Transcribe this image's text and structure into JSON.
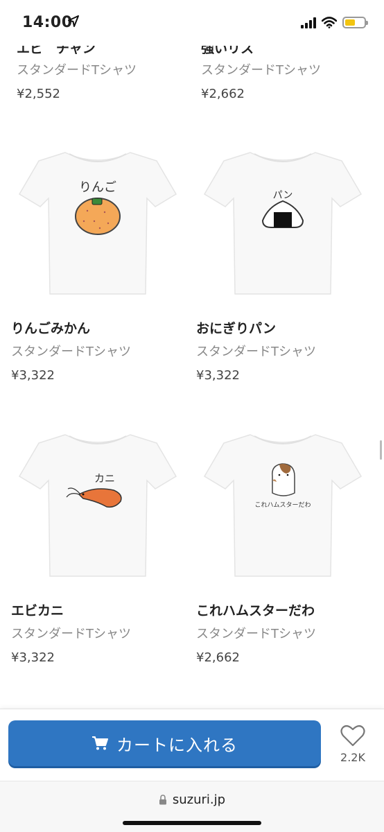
{
  "status_bar": {
    "time": "14:00",
    "location_icon": "location-arrow-icon",
    "signal_icon": "cellular-signal-icon",
    "wifi_icon": "wifi-icon",
    "battery_icon": "battery-icon",
    "battery_color": "#f2c40f"
  },
  "partial_row": [
    {
      "title": "エビ　チャン",
      "type": "スタンダードTシャツ",
      "price": "¥2,552"
    },
    {
      "title": "強いリス",
      "type": "スタンダードTシャツ",
      "price": "¥2,662"
    }
  ],
  "products": [
    {
      "title": "りんごみかん",
      "type": "スタンダードTシャツ",
      "price": "¥3,322",
      "print_text": "りんご"
    },
    {
      "title": "おにぎりパン",
      "type": "スタンダードTシャツ",
      "price": "¥3,322",
      "print_text": "パン"
    },
    {
      "title": "エビカニ",
      "type": "スタンダードTシャツ",
      "price": "¥3,322",
      "print_text": "カニ"
    },
    {
      "title": "これハムスターだわ",
      "type": "スタンダードTシャツ",
      "price": "¥2,662",
      "print_text": "これハムスターだわ"
    }
  ],
  "bottom_bar": {
    "cart_label": "カートに入れる",
    "cart_icon": "cart-icon",
    "cart_color": "#2f76c2",
    "favorite_icon": "heart-icon",
    "favorite_count": "2.2K"
  },
  "url_bar": {
    "url": "suzuri.jp",
    "lock_icon": "lock-icon"
  }
}
